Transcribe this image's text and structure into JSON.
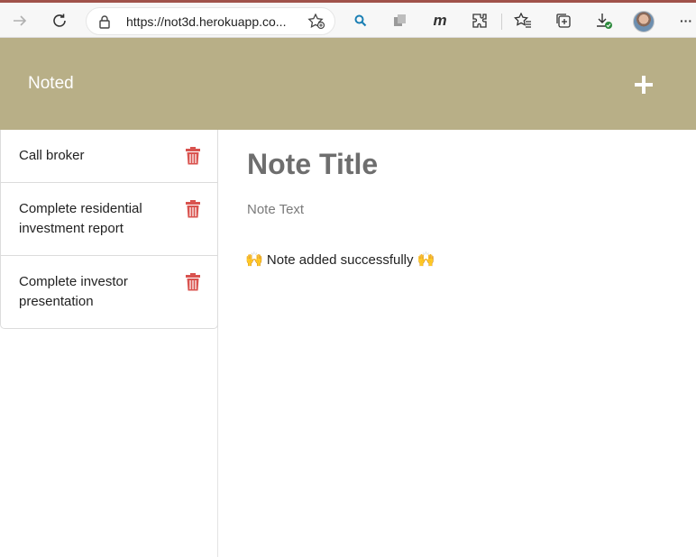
{
  "browser": {
    "url": "https://not3d.herokuapp.co...",
    "icons": [
      "forward-icon",
      "refresh-icon",
      "lock-icon",
      "add-favorite-icon",
      "search-extension-icon",
      "collections-extension-icon",
      "m-extension-icon",
      "extensions-icon",
      "favorites-icon",
      "collections-icon",
      "downloads-icon",
      "profile-avatar",
      "more-icon"
    ],
    "m_glyph": "m",
    "more_glyph": "···"
  },
  "header": {
    "brand": "Noted",
    "add_icon": "plus-icon"
  },
  "notes": [
    {
      "title": "Call broker"
    },
    {
      "title": "Complete residential investment report"
    },
    {
      "title": "Complete investor presentation"
    }
  ],
  "editor": {
    "title_placeholder": "Note Title",
    "text_placeholder": "Note Text"
  },
  "alert": {
    "emoji_left": "🙌",
    "message": "Note added successfully",
    "emoji_right": "🙌"
  },
  "colors": {
    "header_bg": "#b8af87",
    "trash": "#d9534f",
    "title_placeholder": "#6e6e6e"
  }
}
